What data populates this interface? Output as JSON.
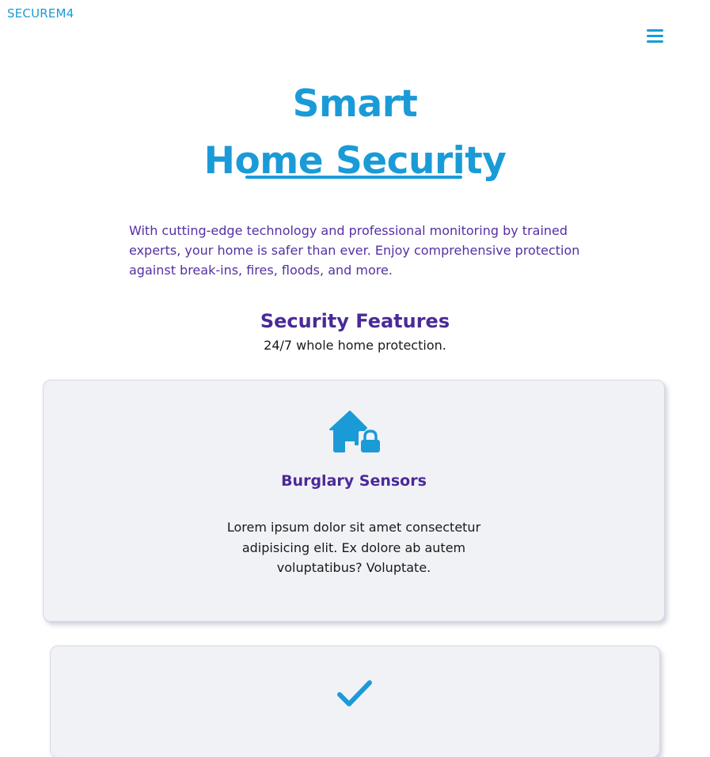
{
  "brand": "SECUREM4",
  "nav": {
    "menu_icon": "hamburger-menu-icon"
  },
  "hero": {
    "title_line1": "Smart",
    "title_line2": "Home Security",
    "intro": "With cutting-edge technology and professional monitoring by trained experts, your home is safer than ever. Enjoy comprehensive protection against break-ins, fires, floods, and more."
  },
  "features": {
    "title": "Security Features",
    "subtitle": "24/7 whole home protection.",
    "cards": [
      {
        "icon": "house-lock-icon",
        "title": "Burglary Sensors",
        "text": "Lorem ipsum dolor sit amet consectetur adipisicing elit. Ex dolore ab autem voluptatibus? Voluptate."
      },
      {
        "icon": "checkmark-icon"
      }
    ]
  },
  "colors": {
    "accent": "#1a9bd7",
    "heading_purple": "#4a2a98",
    "intro_purple": "#5530a4",
    "card_bg": "#f1f2f6"
  }
}
